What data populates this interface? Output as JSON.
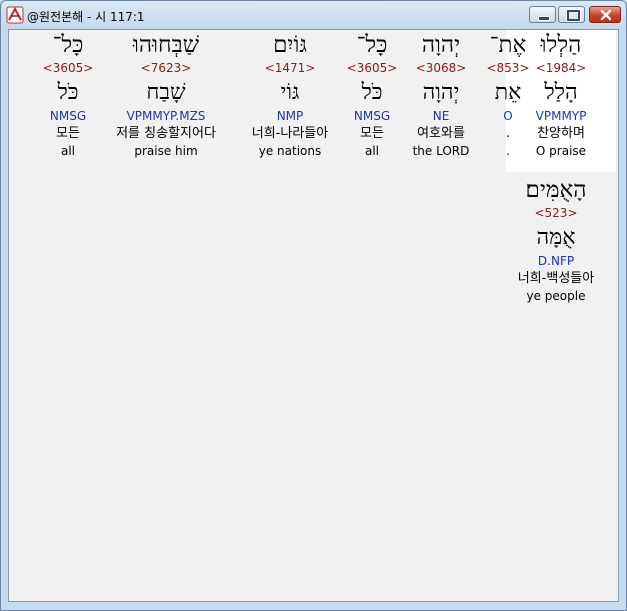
{
  "window": {
    "title": "@원전본해 - 시 117:1"
  },
  "icons": {
    "app": "app-logo-icon",
    "minimize": "minimize-icon",
    "maximize": "maximize-icon",
    "close": "close-icon"
  },
  "colors": {
    "strongs": "#8b1a1a",
    "morph": "#1f33b5"
  },
  "words": [
    {
      "hebrew": "הַלְלוּ",
      "strongs": "<1984>",
      "lemma": "הָלַל",
      "morph": "VPMMYP",
      "korean": "찬양하며",
      "english": "O praise",
      "highlight": true
    },
    {
      "hebrew": "אֶת־",
      "strongs": "<853>",
      "lemma": "אֵת",
      "morph": "O",
      "korean": ".",
      "english": ".",
      "highlight": false
    },
    {
      "hebrew": "יְהוָה",
      "strongs": "<3068>",
      "lemma": "יְהוָה",
      "morph": "NE",
      "korean": "여호와를",
      "english": "the LORD",
      "highlight": false
    },
    {
      "hebrew": "כָּל־",
      "strongs": "<3605>",
      "lemma": "כֹּל",
      "morph": "NMSG",
      "korean": "모든",
      "english": "all",
      "highlight": false
    },
    {
      "hebrew": "גּוֹיִם",
      "strongs": "<1471>",
      "lemma": "גּוֹי",
      "morph": "NMP",
      "korean": "너희-나라들아",
      "english": "ye nations",
      "highlight": false
    },
    {
      "hebrew": "שַׁבְּחוּהוּ",
      "strongs": "<7623>",
      "lemma": "שָׁבַח",
      "morph": "VPMMYP.MZS",
      "korean": "저를 칭송할지어다",
      "english": "praise him",
      "highlight": false
    },
    {
      "hebrew": "כָּל־",
      "strongs": "<3605>",
      "lemma": "כֹּל",
      "morph": "NMSG",
      "korean": "모든",
      "english": "all",
      "highlight": false
    },
    {
      "hebrew": "הָאֻמִּים׃",
      "strongs": "<523>",
      "lemma": "אֻמָּה",
      "morph": "D.NFP",
      "korean": "너희-백성들아",
      "english": "ye people",
      "highlight": false
    }
  ]
}
